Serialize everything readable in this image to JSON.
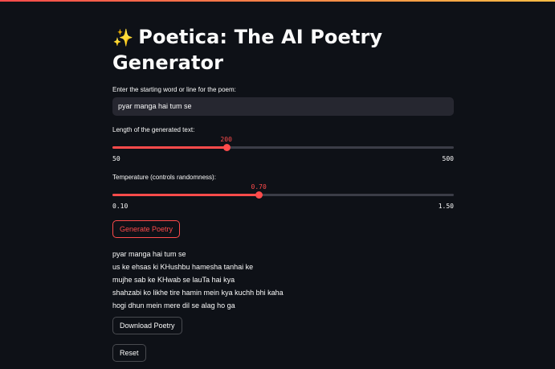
{
  "app": {
    "title_icon": "sparkles-icon",
    "title": "Poetica: The AI Poetry Generator"
  },
  "input": {
    "label": "Enter the starting word or line for the poem:",
    "value": "pyar manga hai tum se"
  },
  "length_slider": {
    "label": "Length of the generated text:",
    "value": 200,
    "value_text": "200",
    "min": 50,
    "max": 500,
    "min_text": "50",
    "max_text": "500"
  },
  "temperature_slider": {
    "label": "Temperature (controls randomness):",
    "value": 0.7,
    "value_text": "0.70",
    "min": 0.1,
    "max": 1.5,
    "min_text": "0.10",
    "max_text": "1.50"
  },
  "buttons": {
    "generate": "Generate Poetry",
    "download": "Download Poetry",
    "reset": "Reset"
  },
  "poem": {
    "lines": [
      "pyar manga hai tum se",
      "us ke ehsas ki KHushbu hamesha tanhai ke",
      "mujhe sab ke KHwab se lauTa hai kya",
      "shahzabi ko likhe tire hamin mein kya kuchh bhi kaha",
      "hogi dhun mein mere dil se alag ho ga"
    ]
  },
  "colors": {
    "background": "#0e1117",
    "accent": "#ff4b4b",
    "input_bg": "#262730",
    "text": "#fafafa"
  }
}
